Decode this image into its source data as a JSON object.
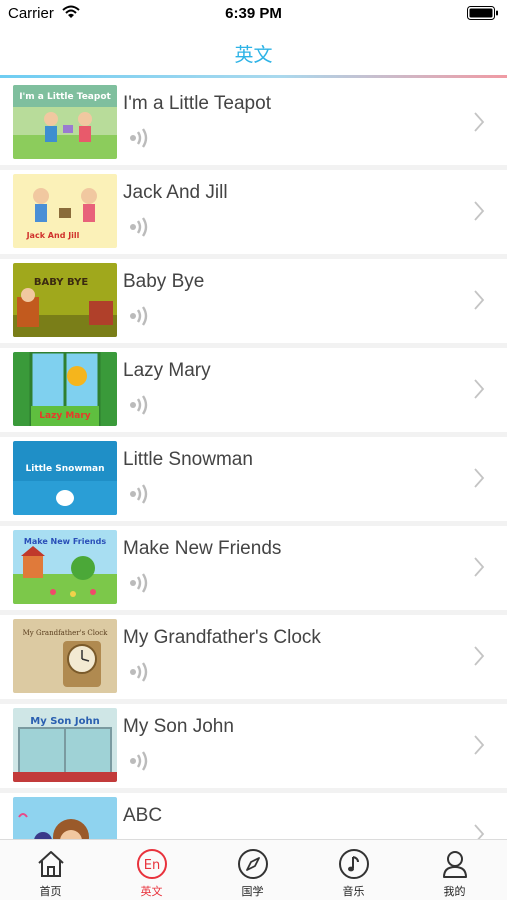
{
  "status_bar": {
    "carrier": "Carrier",
    "time": "6:39 PM"
  },
  "header": {
    "title": "英文"
  },
  "colors": {
    "accent": "#2eb3e6",
    "active_tab": "#e8323c"
  },
  "songs": [
    {
      "title": "I'm a Little Teapot",
      "icon": "sound-icon",
      "thumbnail_text": "I'm a Little Teapot"
    },
    {
      "title": "Jack And Jill",
      "icon": "sound-icon",
      "thumbnail_text": "Jack And Jill"
    },
    {
      "title": "Baby Bye",
      "icon": "sound-icon",
      "thumbnail_text": "BABY BYE"
    },
    {
      "title": "Lazy Mary",
      "icon": "sound-icon",
      "thumbnail_text": "Lazy Mary"
    },
    {
      "title": "Little Snowman",
      "icon": "sound-icon",
      "thumbnail_text": "Little Snowman"
    },
    {
      "title": "Make New Friends",
      "icon": "sound-icon",
      "thumbnail_text": "Make New Friends"
    },
    {
      "title": "My Grandfather's Clock",
      "icon": "sound-icon",
      "thumbnail_text": "My Grandfather's Clock"
    },
    {
      "title": "My Son John",
      "icon": "sound-icon",
      "thumbnail_text": "My Son John"
    },
    {
      "title": "ABC",
      "icon": "sound-icon",
      "thumbnail_text": ""
    }
  ],
  "tabs": [
    {
      "label": "首页",
      "icon": "home-icon"
    },
    {
      "label": "英文",
      "icon": "english-icon",
      "active": true,
      "icon_text": "En"
    },
    {
      "label": "国学",
      "icon": "compass-icon"
    },
    {
      "label": "音乐",
      "icon": "music-note-icon"
    },
    {
      "label": "我的",
      "icon": "profile-icon"
    }
  ]
}
